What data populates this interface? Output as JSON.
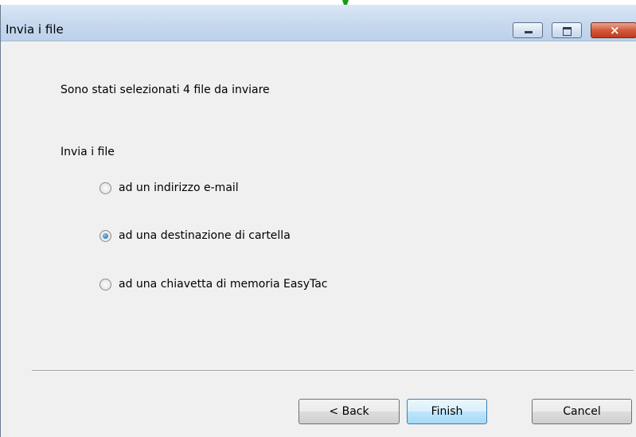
{
  "window": {
    "title": "Invia i file",
    "controls": {
      "minimize": "minimize",
      "maximize": "maximize",
      "close": "×"
    }
  },
  "main": {
    "intro_text": "Sono stati selezionati 4 file da inviare",
    "group_label": "Invia i file",
    "options": [
      {
        "label": "ad un indirizzo e-mail",
        "checked": false
      },
      {
        "label": "ad una destinazione di cartella",
        "checked": true
      },
      {
        "label": "ad una chiavetta di memoria EasyTac",
        "checked": false
      }
    ]
  },
  "footer": {
    "back_label": "< Back",
    "finish_label": "Finish",
    "cancel_label": "Cancel"
  },
  "colors": {
    "titlebar": "#c5d8ee",
    "close_button": "#d45a3c",
    "radio_checked": "#1b5ca8",
    "default_button_border": "#3c7fb1",
    "cursor_arrow": "#1a9a1a"
  }
}
